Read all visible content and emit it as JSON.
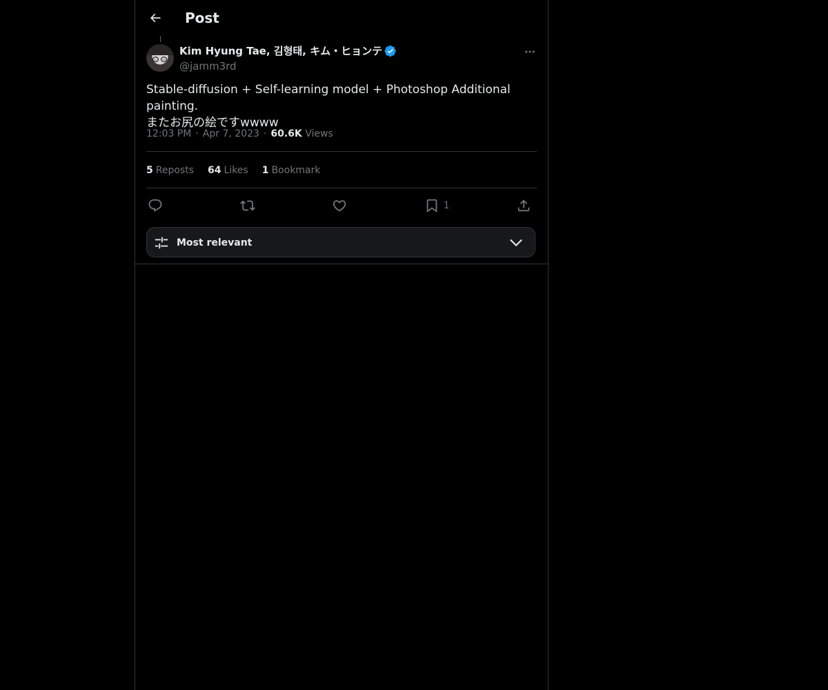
{
  "header": {
    "title": "Post"
  },
  "post": {
    "author": {
      "display_name": "Kim Hyung Tae, 김형태, キム・ヒョンテ",
      "handle": "@jamm3rd",
      "verified": true
    },
    "text": "Stable-diffusion + Self-learning model + Photoshop Additional painting.\nまたお尻の絵ですwwww",
    "time": "12:03 PM",
    "date": "Apr 7, 2023",
    "views_count": "60.6K",
    "views_label": "Views",
    "stats": {
      "reposts_count": "5",
      "reposts_label": "Reposts",
      "likes_count": "64",
      "likes_label": "Likes",
      "bookmarks_count": "1",
      "bookmarks_label": "Bookmark"
    },
    "actions": {
      "reply_icon": "reply-icon",
      "repost_icon": "repost-icon",
      "like_icon": "heart-icon",
      "bookmark_icon": "bookmark-icon",
      "bookmark_count": "1",
      "share_icon": "share-icon"
    }
  },
  "replies_sort": {
    "label": "Most relevant"
  },
  "colors": {
    "background": "#000000",
    "text_primary": "#e7e9ea",
    "text_secondary": "#71767b",
    "border": "#2f3336",
    "verified_blue": "#1d9bf0",
    "sort_bar_bg": "#16181c"
  }
}
